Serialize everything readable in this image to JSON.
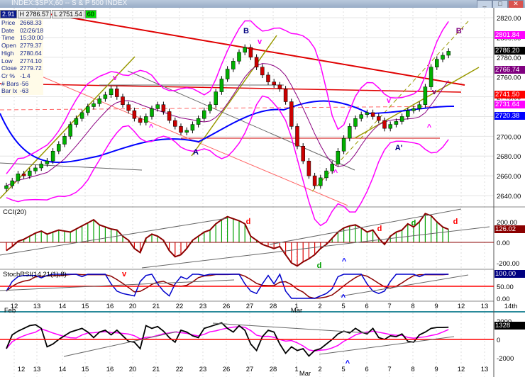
{
  "window": {
    "title": "INDEX:$SPX,60 -- S & P 500 INDEX",
    "buttons": [
      "_",
      "□",
      "✕"
    ]
  },
  "ohlc_bar": {
    "c": "2.91",
    "h": "H 2786.57",
    "l": "L 2751.54",
    "interval": "60"
  },
  "info": [
    [
      "Price",
      "2668.33"
    ],
    [
      "Date",
      "02/26/18"
    ],
    [
      "Time",
      "15:30:00"
    ],
    [
      "Open",
      "2779.37"
    ],
    [
      "High",
      "2780.64"
    ],
    [
      "Low",
      "2774.10"
    ],
    [
      "Close",
      "2779.72"
    ],
    [
      "Cr %",
      "-1.4"
    ],
    [
      "# Bars",
      "-56"
    ],
    [
      "Bar Ix",
      "-63"
    ]
  ],
  "colors": {
    "up": "#00b000",
    "down": "#cc0000",
    "bollinger": "#ff00ff",
    "ma_blue": "#0000ff",
    "ma_red": "#ff0000",
    "trend": "#999900"
  },
  "annotations": {
    "B": "B",
    "B_prime": "B'",
    "A": "A",
    "A_prime": "A'",
    "v": "v",
    "caret": "^",
    "d": "d"
  },
  "chart_data": [
    {
      "type": "candlestick",
      "title": "INDEX:$SPX,60",
      "ylim": [
        2630,
        2830
      ],
      "y_ticks": [
        "2820.00",
        "2800.00",
        "2780.00",
        "2760.00",
        "2740.00",
        "2720.00",
        "2700.00",
        "2680.00",
        "2660.00",
        "2640.00"
      ],
      "tags": [
        {
          "label": "2801.84",
          "color": "#ff00ff"
        },
        {
          "label": "2786.20",
          "color": "#000000"
        },
        {
          "label": "2766.74",
          "color": "#800080"
        },
        {
          "label": "2741.50",
          "color": "#ff0000"
        },
        {
          "label": "2731.64",
          "color": "#ff00ff"
        },
        {
          "label": "2720.38",
          "color": "#0000ff"
        }
      ],
      "closes": [
        2650,
        2655,
        2662,
        2660,
        2665,
        2668,
        2672,
        2675,
        2685,
        2692,
        2700,
        2712,
        2718,
        2724,
        2730,
        2733,
        2738,
        2742,
        2748,
        2740,
        2732,
        2726,
        2718,
        2714,
        2720,
        2728,
        2732,
        2725,
        2716,
        2710,
        2704,
        2706,
        2712,
        2718,
        2726,
        2732,
        2745,
        2758,
        2768,
        2776,
        2785,
        2790,
        2780,
        2770,
        2762,
        2755,
        2752,
        2748,
        2735,
        2710,
        2690,
        2675,
        2660,
        2650,
        2658,
        2665,
        2672,
        2685,
        2698,
        2710,
        2718,
        2722,
        2724,
        2720,
        2716,
        2708,
        2712,
        2715,
        2720,
        2726,
        2728,
        2732,
        2750,
        2770,
        2778,
        2782,
        2786
      ]
    },
    {
      "type": "bar",
      "title": "CCI(20)",
      "ylim": [
        -250,
        300
      ],
      "y_ticks": [
        "200.00",
        "0.00",
        "-200.00"
      ],
      "tag": "126.02",
      "values": [
        -80,
        -40,
        10,
        30,
        60,
        90,
        110,
        80,
        100,
        120,
        110,
        100,
        130,
        160,
        190,
        220,
        170,
        150,
        130,
        120,
        60,
        20,
        -60,
        -100,
        40,
        80,
        60,
        20,
        -80,
        -140,
        -120,
        -60,
        20,
        60,
        100,
        120,
        180,
        220,
        250,
        230,
        210,
        180,
        60,
        20,
        -20,
        -40,
        -60,
        -40,
        -120,
        -200,
        -230,
        -190,
        -160,
        -120,
        -60,
        -20,
        40,
        100,
        140,
        160,
        170,
        140,
        100,
        120,
        40,
        -20,
        60,
        100,
        120,
        180,
        150,
        200,
        280,
        260,
        200,
        150,
        126
      ]
    },
    {
      "type": "line",
      "title": "StochRSI(14,21(1),8)",
      "ylim": [
        0,
        100
      ],
      "y_ticks": [
        "100.00",
        "50.00",
        "0.00"
      ],
      "tag": "100.00",
      "values": [
        30,
        70,
        90,
        95,
        95,
        95,
        85,
        95,
        100,
        100,
        100,
        100,
        100,
        90,
        100,
        100,
        100,
        100,
        60,
        30,
        20,
        15,
        10,
        70,
        95,
        100,
        60,
        30,
        10,
        60,
        90,
        80,
        100,
        100,
        95,
        100,
        100,
        100,
        100,
        100,
        100,
        60,
        30,
        20,
        60,
        95,
        60,
        100,
        30,
        0,
        0,
        0,
        0,
        0,
        10,
        20,
        40,
        90,
        100,
        100,
        100,
        100,
        60,
        30,
        20,
        30,
        70,
        100,
        100,
        100,
        100,
        90,
        100,
        100,
        100,
        100,
        100
      ]
    },
    {
      "type": "line",
      "ylim": [
        -2500,
        2500
      ],
      "y_ticks": [
        "2000",
        "0",
        "-2000"
      ],
      "tag": "1328",
      "values": [
        -1000,
        500,
        900,
        1200,
        1500,
        1600,
        1200,
        -800,
        -500,
        0,
        400,
        800,
        1000,
        1200,
        800,
        200,
        800,
        1000,
        500,
        1000,
        400,
        -200,
        -300,
        -1000,
        1500,
        1200,
        1400,
        900,
        200,
        -300,
        1000,
        800,
        400,
        200,
        1200,
        1400,
        1600,
        1800,
        1200,
        800,
        1500,
        1000,
        -500,
        -1200,
        300,
        1000,
        800,
        -500,
        -1500,
        -800,
        -1200,
        -1000,
        -1800,
        -1200,
        -1000,
        -500,
        0,
        600,
        900,
        700,
        1200,
        800,
        600,
        1200,
        200,
        0,
        400,
        300,
        600,
        -200,
        -300,
        500,
        800,
        1200,
        1300,
        1300,
        1328
      ]
    }
  ],
  "x_ticks": [
    "12",
    "13",
    "14",
    "15",
    "16",
    "20",
    "21",
    "22",
    "23",
    "26",
    "27",
    "28",
    "1",
    "2",
    "5",
    "6",
    "7",
    "8",
    "9",
    "12",
    "13",
    "14th"
  ],
  "x_month_labels": {
    "feb": "Feb",
    "mar": "Mar"
  }
}
